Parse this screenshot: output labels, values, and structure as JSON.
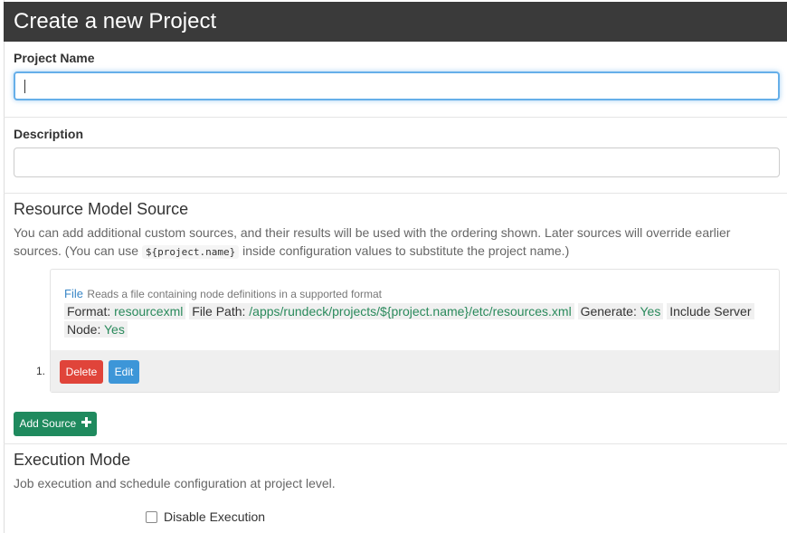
{
  "header": {
    "title": "Create a new Project"
  },
  "project_name": {
    "label": "Project Name",
    "value": "",
    "placeholder": ""
  },
  "description": {
    "label": "Description",
    "value": "",
    "placeholder": ""
  },
  "resource_model": {
    "title": "Resource Model Source",
    "help_line1": "You can add additional custom sources, and their results will be used with the ordering shown. Later sources will override earlier",
    "help_pre": "sources. (You can use",
    "help_code": "${project.name}",
    "help_post": "inside configuration values to substitute the project name.)",
    "sources": [
      {
        "index": "1.",
        "name": "File",
        "desc": "Reads a file containing node definitions in a supported format",
        "format_key": "Format:",
        "format_val": "resourcexml",
        "path_key": "File Path:",
        "path_val": "/apps/rundeck/projects/${project.name}/etc/resources.xml",
        "generate_key": "Generate:",
        "generate_val": "Yes",
        "include_key_1": "Include Server",
        "include_key_2": "Node:",
        "include_val": "Yes",
        "delete_label": "Delete",
        "edit_label": "Edit"
      }
    ],
    "add_label": "Add Source",
    "add_icon": "plus-icon"
  },
  "execution_mode": {
    "title": "Execution Mode",
    "help": "Job execution and schedule configuration at project level.",
    "disable_label": "Disable Execution",
    "disable_checked": false
  },
  "colors": {
    "header_bg": "#3a3a3a",
    "delete": "#e0443a",
    "edit": "#3d96d8",
    "add": "#1f8a5e",
    "value_green": "#2a8a5c",
    "link_blue": "#3a87c7"
  }
}
